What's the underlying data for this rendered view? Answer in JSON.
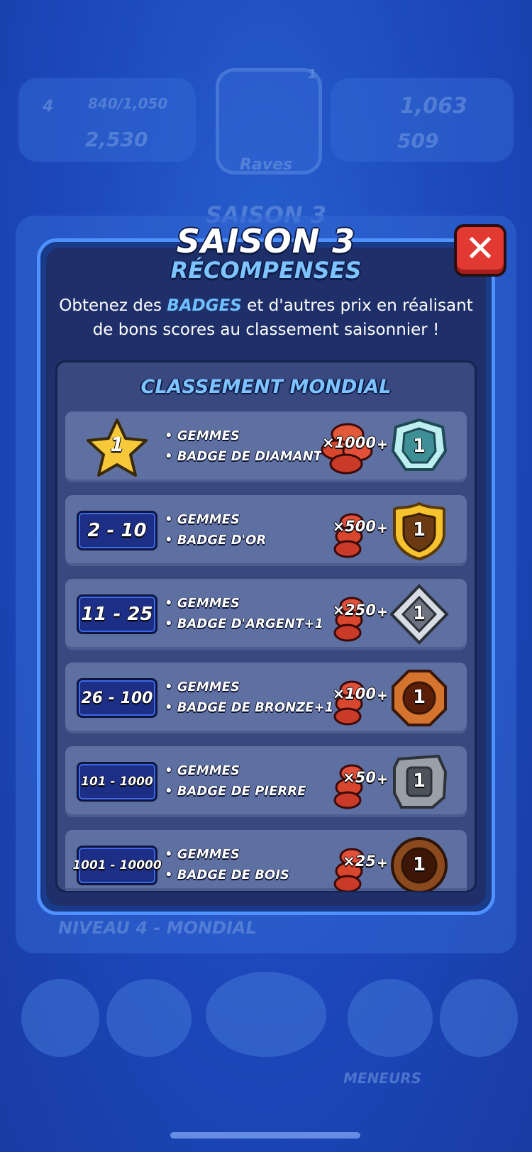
{
  "background": {
    "trophy_progress": "840/1,050",
    "level": "4",
    "gems_left": "2,530",
    "coins_right": "1,063",
    "gems_right": "509",
    "center_tile_label": "Raves",
    "center_badge": "1",
    "season_heading": "SAISON 3",
    "level_label": "NIVEAU 4 - MONDIAL",
    "nav_label": "MENEURS"
  },
  "modal": {
    "title": "SAISON 3",
    "subtitle": "RÉCOMPENSES",
    "description_pre": "Obtenez des ",
    "description_highlight": "BADGES",
    "description_post": " et d'autres prix en réalisant de bons scores au classement saisonnier !",
    "close_label": "✕",
    "panel_title": "CLASSEMENT MONDIAL",
    "rows": [
      {
        "rank": "1",
        "line1": "• GEMMES",
        "line2": "• BADGE DE DIAMANT",
        "gems": "×1000",
        "plus": "+",
        "badge_num": "1",
        "badge_tier": "diamond"
      },
      {
        "rank": "2 - 10",
        "line1": "• GEMMES",
        "line2": "• BADGE D'OR",
        "gems": "×500",
        "plus": "+",
        "badge_num": "1",
        "badge_tier": "gold"
      },
      {
        "rank": "11 - 25",
        "line1": "• GEMMES",
        "line2": "• BADGE D'ARGENT+1",
        "gems": "×250",
        "plus": "+",
        "badge_num": "1",
        "badge_tier": "silver"
      },
      {
        "rank": "26 - 100",
        "line1": "• GEMMES",
        "line2": "• BADGE DE BRONZE+1",
        "gems": "×100",
        "plus": "+",
        "badge_num": "1",
        "badge_tier": "bronze"
      },
      {
        "rank": "101 - 1000",
        "line1": "• GEMMES",
        "line2": "• BADGE DE PIERRE",
        "gems": "×50",
        "plus": "+",
        "badge_num": "1",
        "badge_tier": "stone"
      },
      {
        "rank": "1001 - 10000",
        "line1": "• GEMMES",
        "line2": "• BADGE DE BOIS",
        "gems": "×25",
        "plus": "+",
        "badge_num": "1",
        "badge_tier": "wood"
      }
    ]
  },
  "colors": {
    "accent_blue": "#7cc3ff",
    "close_red": "#e23a33",
    "row_bg": "#5e6fa1"
  }
}
